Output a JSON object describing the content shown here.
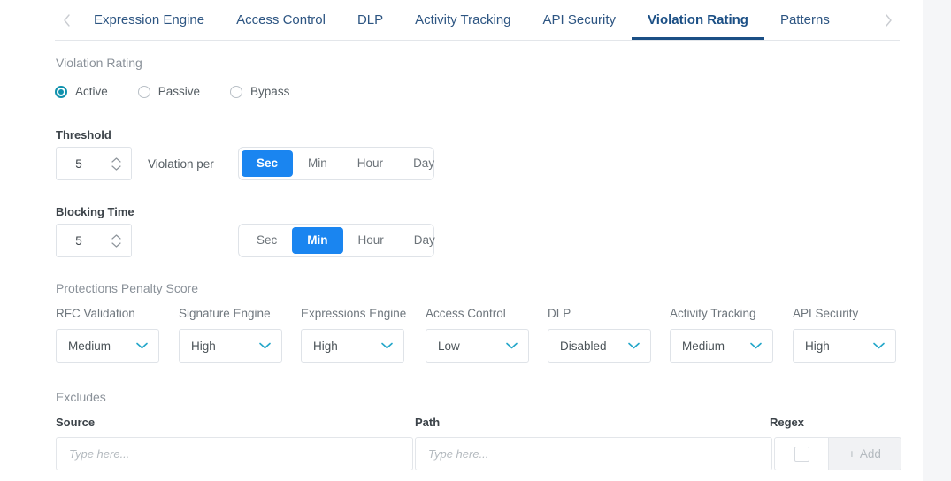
{
  "tabbar": {
    "prev_icon": "chevron-left-icon",
    "next_icon": "chevron-right-icon",
    "tabs": [
      {
        "label": "Expression Engine",
        "active": false
      },
      {
        "label": "Access Control",
        "active": false
      },
      {
        "label": "DLP",
        "active": false
      },
      {
        "label": "Activity Tracking",
        "active": false
      },
      {
        "label": "API Security",
        "active": false
      },
      {
        "label": "Violation Rating",
        "active": true
      },
      {
        "label": "Patterns",
        "active": false
      }
    ],
    "active_color": "#1b4f85",
    "tab_color": "#2d5582"
  },
  "violation_rating": {
    "section_title": "Violation Rating",
    "options": [
      {
        "label": "Active",
        "selected": true
      },
      {
        "label": "Passive",
        "selected": false
      },
      {
        "label": "Bypass",
        "selected": false
      }
    ],
    "selected_color": "#0f91ad"
  },
  "threshold": {
    "label": "Threshold",
    "value": "5",
    "inline_label": "Violation per",
    "units": [
      {
        "label": "Sec",
        "active": true
      },
      {
        "label": "Min",
        "active": false
      },
      {
        "label": "Hour",
        "active": false
      },
      {
        "label": "Day",
        "active": false
      }
    ]
  },
  "blocking_time": {
    "label": "Blocking Time",
    "value": "5",
    "units": [
      {
        "label": "Sec",
        "active": false
      },
      {
        "label": "Min",
        "active": true
      },
      {
        "label": "Hour",
        "active": false
      },
      {
        "label": "Day",
        "active": false
      }
    ]
  },
  "penalty": {
    "section_title": "Protections Penalty Score",
    "accent_color": "#22a6c9",
    "columns": [
      {
        "label": "RFC Validation",
        "value": "Medium"
      },
      {
        "label": "Signature Engine",
        "value": "High"
      },
      {
        "label": "Expressions Engine",
        "value": "High"
      },
      {
        "label": "Access Control",
        "value": "Low"
      },
      {
        "label": "DLP",
        "value": "Disabled"
      },
      {
        "label": "Activity Tracking",
        "value": "Medium"
      },
      {
        "label": "API Security",
        "value": "High"
      }
    ]
  },
  "excludes": {
    "section_title": "Excludes",
    "headers": {
      "source": "Source",
      "path": "Path",
      "regex": "Regex"
    },
    "source_placeholder": "Type here...",
    "path_placeholder": "Type here...",
    "regex_checked": false,
    "add_label": "Add",
    "add_icon": "plus-icon"
  },
  "selected_toggle_color": "#1a85f0"
}
